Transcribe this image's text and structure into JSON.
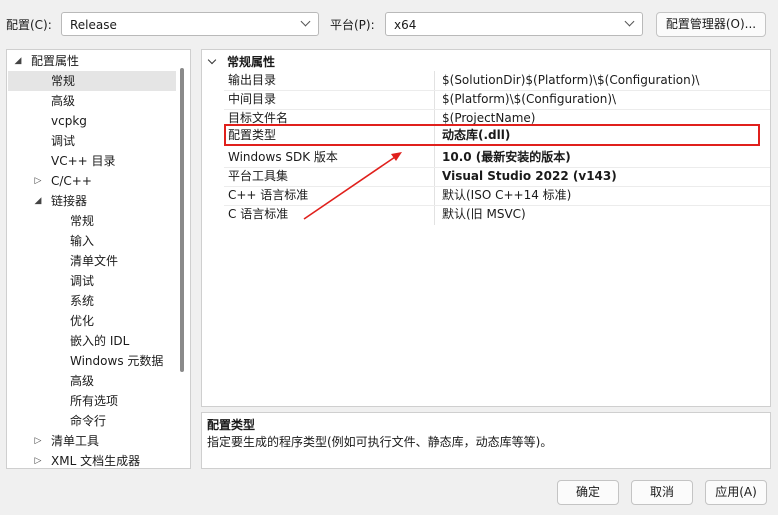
{
  "topbar": {
    "config_label": "配置(C):",
    "config_value": "Release",
    "platform_label": "平台(P):",
    "platform_value": "x64",
    "config_manager_button": "配置管理器(O)..."
  },
  "tree": {
    "items": [
      {
        "label": "配置属性",
        "expander": "◢"
      },
      {
        "label": "常规"
      },
      {
        "label": "高级"
      },
      {
        "label": "vcpkg"
      },
      {
        "label": "调试"
      },
      {
        "label": "VC++ 目录"
      },
      {
        "label": "C/C++",
        "expander": "▷"
      },
      {
        "label": "链接器",
        "expander": "◢"
      },
      {
        "label": "常规"
      },
      {
        "label": "输入"
      },
      {
        "label": "清单文件"
      },
      {
        "label": "调试"
      },
      {
        "label": "系统"
      },
      {
        "label": "优化"
      },
      {
        "label": "嵌入的 IDL"
      },
      {
        "label": "Windows 元数据"
      },
      {
        "label": "高级"
      },
      {
        "label": "所有选项"
      },
      {
        "label": "命令行"
      },
      {
        "label": "清单工具",
        "expander": "▷"
      },
      {
        "label": "XML 文档生成器",
        "expander": "▷"
      }
    ]
  },
  "grid": {
    "category": "常规属性",
    "properties": [
      {
        "name": "输出目录",
        "value": "$(SolutionDir)$(Platform)\\$(Configuration)\\"
      },
      {
        "name": "中间目录",
        "value": "$(Platform)\\$(Configuration)\\"
      },
      {
        "name": "目标文件名",
        "value": "$(ProjectName)"
      },
      {
        "name": "配置类型",
        "value": "动态库(.dll)"
      },
      {
        "name": "Windows SDK 版本",
        "value": "10.0 (最新安装的版本)"
      },
      {
        "name": "平台工具集",
        "value": "Visual Studio 2022 (v143)"
      },
      {
        "name": "C++ 语言标准",
        "value": "默认(ISO C++14 标准)"
      },
      {
        "name": "C 语言标准",
        "value": "默认(旧 MSVC)"
      }
    ]
  },
  "description": {
    "title": "配置类型",
    "text": "指定要生成的程序类型(例如可执行文件、静态库，动态库等等)。"
  },
  "footer": {
    "ok": "确定",
    "cancel": "取消",
    "apply": "应用(A)"
  },
  "colors": {
    "highlight": "#e0201c",
    "selection": "#e5e5e5"
  }
}
